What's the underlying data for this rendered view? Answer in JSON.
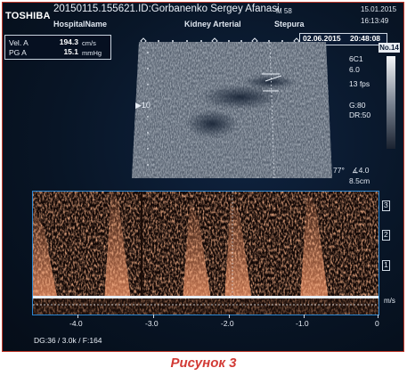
{
  "header": {
    "brand": "TOSHIBA",
    "patient_id": "20150115.155621.ID:Gorbanenko Sergey Afanasi",
    "m_index": "M 58",
    "date": "15.01.2015",
    "time": "16:13:49",
    "hospital": "HospitalName",
    "exam": "Kidney Arterial",
    "operator": "Stepura"
  },
  "measurements": [
    {
      "label": "Vel. A",
      "value": "194.3",
      "unit": "cm/s"
    },
    {
      "label": "PG  A",
      "value": "15.1",
      "unit": "mmHg"
    }
  ],
  "image_date": "02.06.2015",
  "image_time": "20:48:08",
  "frame_no": "No.14",
  "params": [
    "6C1",
    "6.0",
    "13 fps",
    "G:80",
    "DR:50"
  ],
  "angle": "77°",
  "angle_value": "4.0",
  "depth": "8.5cm",
  "focus_marker": "▶10",
  "velocity_scale": [
    "3",
    "2",
    "1"
  ],
  "velocity_unit": "m/s",
  "time_axis": [
    "-4.0",
    "-3.0",
    "-2.0",
    "-1.0",
    "0"
  ],
  "footer": "DG:36  / 3.0k   / F:164",
  "caption": "Рисунок 3"
}
